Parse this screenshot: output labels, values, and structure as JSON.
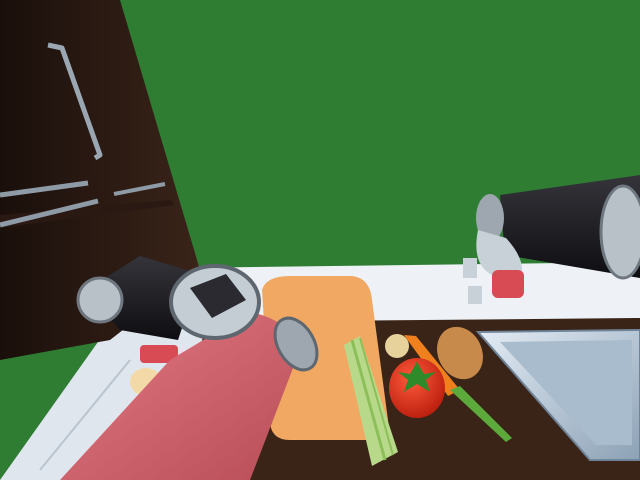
{
  "scene": {
    "objects": [
      "fridge",
      "fridge-handle-vertical",
      "freezer-handle",
      "cutting-board",
      "celery",
      "tomato",
      "carrot",
      "potato",
      "onion",
      "egg",
      "sink",
      "robot-left-arm",
      "robot-right-arm",
      "counter"
    ]
  },
  "colors": {
    "wall": "#2e7d32",
    "fridge": "#2b1a14",
    "counter_top": "#3a2418",
    "counter_white": "#e8eef4",
    "cutting_board": "#f0a862",
    "robot_body": "#d9656e",
    "robot_dark": "#1e1e22",
    "sink": "#b8c8d8"
  }
}
